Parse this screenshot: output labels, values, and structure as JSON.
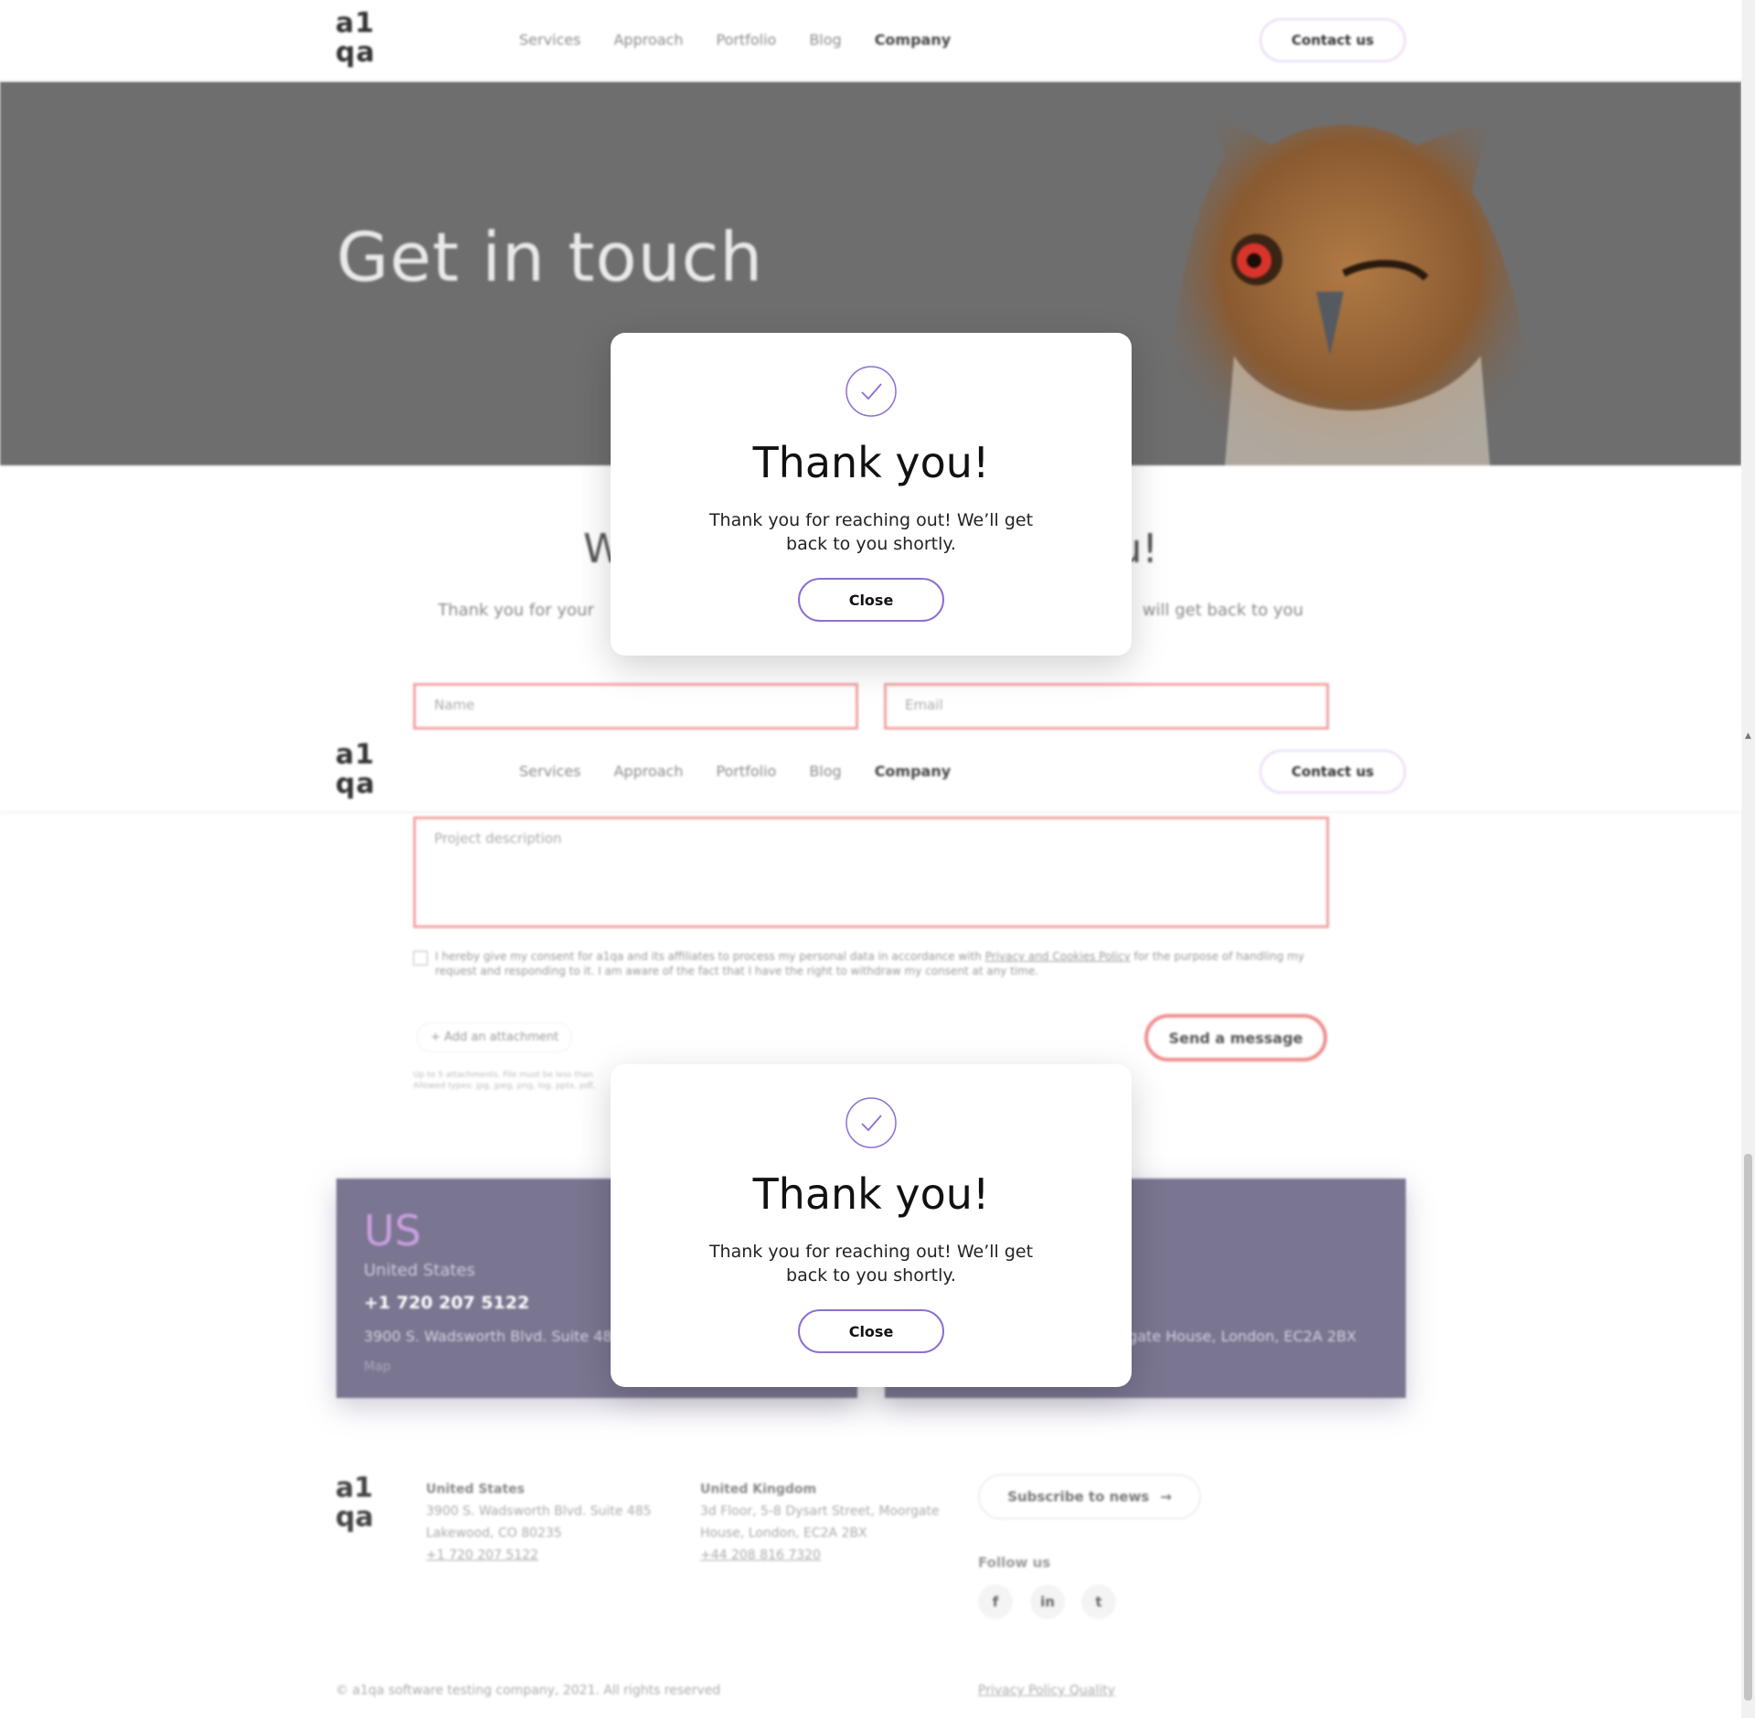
{
  "header": {
    "logo": "a1 qa",
    "nav": [
      "Services",
      "Approach",
      "Portfolio",
      "Blog",
      "Company"
    ],
    "contact_button": "Contact us"
  },
  "hero": {
    "title": "Get in touch"
  },
  "section": {
    "title_left": "W",
    "title_right": "u!",
    "subtitle_left": "Thank you for your",
    "subtitle_right": "will get back to you"
  },
  "form": {
    "name_placeholder": "Name",
    "email_placeholder": "Email",
    "description_placeholder": "Project description",
    "consent_text_1": "I hereby give my consent for a1qa and its affiliates to process my personal data in accordance with",
    "consent_link": "Privacy and Cookies Policy",
    "consent_text_2": "for the purpose of handling my request and responding to it. I am aware of the fact that I have the right to withdraw my consent at any time.",
    "attach_label": "Add an attachment",
    "attach_note_1": "Up to 5 attachments. File must be less than",
    "attach_note_2": "Allowed types: jpg, jpeg, png, log, pptx, pdf,",
    "send_button": "Send a message"
  },
  "offices": [
    {
      "code": "US",
      "country": "United States",
      "phone": "+1 720 207 5122",
      "address": "3900 S. Wadsworth Blvd. Suite 485",
      "map": "Map"
    },
    {
      "address": "orgate House, London, EC2A 2BX"
    }
  ],
  "footer": {
    "logo": "a1 qa",
    "us": {
      "heading": "United States",
      "line1": "3900 S. Wadsworth Blvd. Suite 485",
      "line2": "Lakewood, CO 80235",
      "phone": "+1 720 207 5122"
    },
    "uk": {
      "heading": "United Kingdom",
      "line1": "3d Floor, 5-8 Dysart Street, Moorgate",
      "line2": "House, London, EC2A 2BX",
      "phone": "+44 208 816 7320"
    },
    "subscribe_button": "Subscribe to news",
    "follow_label": "Follow us",
    "social": [
      "f",
      "in",
      "t"
    ],
    "copyright": "© a1qa software testing company, 2021. All rights reserved",
    "policy": "Privacy Policy Quality"
  },
  "modal": {
    "title": "Thank you!",
    "message": "Thank you for reaching out! We’ll get back to you shortly.",
    "close_button": "Close"
  },
  "colors": {
    "accent_purple": "#8c6fd1",
    "error_red": "#f3a3a3",
    "office_card": "#7a7590",
    "hero_bg": "#6e6e6e"
  }
}
